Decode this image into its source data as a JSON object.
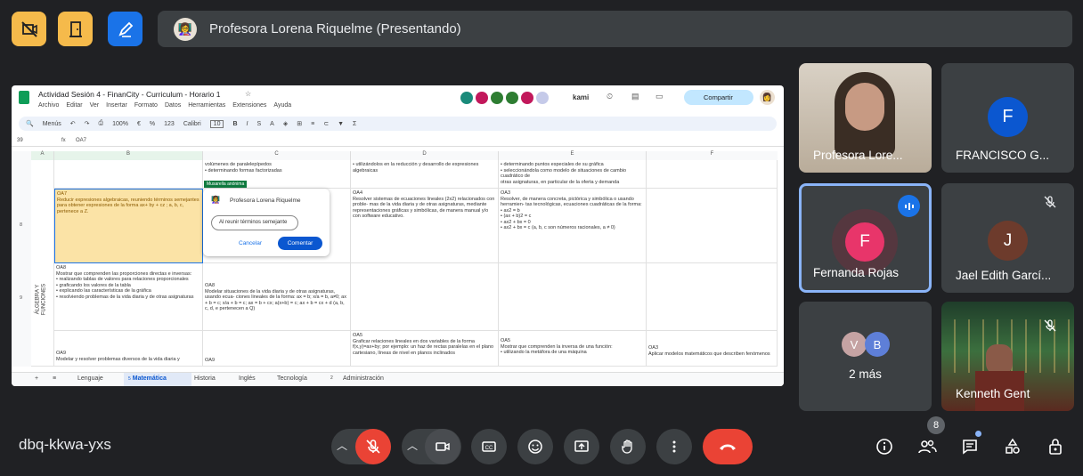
{
  "toolbar": {
    "icons": [
      "no-camera-icon",
      "door-icon",
      "pen-icon"
    ],
    "colors": [
      "#f5ba4b",
      "#f5ba4b",
      "#1a73e8"
    ]
  },
  "banner": {
    "text": "Profesora Lorena Riquelme (Presentando)"
  },
  "sheet": {
    "title": "Actividad Sesión 4 - FinanCity - Curriculum - Horario 1",
    "menu": [
      "Archivo",
      "Editar",
      "Ver",
      "Insertar",
      "Formato",
      "Datos",
      "Herramientas",
      "Extensiones",
      "Ayuda"
    ],
    "menus_label": "Menús",
    "zoom": "100%",
    "font": "Calibri",
    "font_size": "10",
    "share": "Compartir",
    "kami": "kami",
    "num123": "123",
    "cell_ref": "39",
    "formula": "OA7",
    "cols": [
      "A",
      "B",
      "C",
      "D",
      "E",
      "F"
    ],
    "rows": [
      "8",
      "9"
    ],
    "side_label": "ÁLGEBRA Y FUNCIONES",
    "cells": {
      "c_top": "volúmenes de paralelepípedos\n• determinando formas factorizadas",
      "d_top": "• utilizándolos en la reducción y desarrollo de expresiones algebraicas",
      "e_top": "• determinando puntos especiales de su gráfica\n• seleccionándola como modelo de situaciones de cambio cuadrático de\notras asignaturas, en particular de la oferta y demanda",
      "b8": "OA7\nReducir expresiones algebraicas, reuniendo términos semejantes para obtener expresiones de la forma ax+ by + cz ; a, b, c, pertenece a Z.",
      "d8": "OA4\nResolver sistemas de ecuaciones lineales (2x2) relacionados con proble- mas de la vida diaria y de otras asignaturas, mediante representaciones gráficas y simbólicas, de manera manual y/o con software educativo.",
      "e8": "OA3\nResolver, de manera concreta, pictórica y simbólica o usando herramien- tas tecnológicas, ecuaciones cuadráticas de la forma:\n• ax2 = b\n• (ax + b)2 = c\n• ax2 + bx = 0\n• ax2 + bx = c (a, b, c son números racionales, a ≠ 0)",
      "b9": "OA8\nMostrar que comprenden las proporciones directas e inversas:\n• realizando tablas de valores para relaciones proporcionales\n• graficando los valores de la tabla\n• explicando las características de la gráfica\n• resolviendo problemas de la vida diaria y de otras asignaturas",
      "c9": "OA8\nModelar situaciones de la vida diaria y de otras asignaturas, usando ecua- ciones lineales de la forma: ax = b; x/a = b, a≠0; ax + b = c; x/a + b = c; ax = b + cx; a(x+b) = c; ax + b = cx + d   (a, b, c, d, e pertenecen a Q)",
      "b10": "OA9\nModelar y resolver problemas diversos de la vida diaria y",
      "c10": "OA9",
      "d10": "OA5\nGraficar relaciones lineales en dos variables de la forma f(x,y)=ax+by; por ejemplo: un haz de rectas paralelas en el plano cartesiano, líneas de nivel en planos inclinados",
      "e10": "OA5\nMostrar que comprenden la inversa de una función:\n• utilizando la metáfora de una máquina",
      "f10": "OA3\nAplicar modelos matemáticos que describen fenómenos"
    },
    "chip": "Musarella anónima",
    "comment": {
      "author": "Profesora Lorena Riquelme",
      "text": "Al reunir términos semejante",
      "cancel": "Cancelar",
      "submit": "Comentar"
    },
    "tabs": [
      "Lenguaje",
      "Matemática",
      "Historia",
      "Inglés",
      "Tecnología",
      "Administración"
    ],
    "tab_badges": {
      "matematica": "5",
      "administracion": "2"
    }
  },
  "participants": [
    {
      "name": "Profesora Lore...",
      "initial": "",
      "color": "#5b4a3a"
    },
    {
      "name": "FRANCISCO G...",
      "initial": "F",
      "color": "#0b57d0"
    },
    {
      "name": "Fernanda Rojas",
      "initial": "F",
      "color": "#e8356a"
    },
    {
      "name": "Jael Edith Garcí...",
      "initial": "J",
      "color": "#6d3b2c"
    },
    {
      "name": "2 más",
      "initial": "",
      "color": ""
    },
    {
      "name": "Kenneth Gent",
      "initial": "",
      "color": ""
    }
  ],
  "more_avatars": [
    {
      "initial": "V",
      "color": "#c5a3a3"
    },
    {
      "initial": "B",
      "color": "#5e7fd8"
    }
  ],
  "meeting": {
    "code": "dbq-kkwa-yxs",
    "people_count": "8"
  },
  "controls": [
    "chevron-up-icon",
    "mic-off-icon",
    "chevron-up-icon",
    "camera-icon",
    "captions-icon",
    "emoji-icon",
    "present-icon",
    "raise-hand-icon",
    "more-icon",
    "end-call-icon"
  ],
  "right_controls": [
    "info-icon",
    "people-icon",
    "chat-icon",
    "activities-icon",
    "host-controls-icon"
  ]
}
